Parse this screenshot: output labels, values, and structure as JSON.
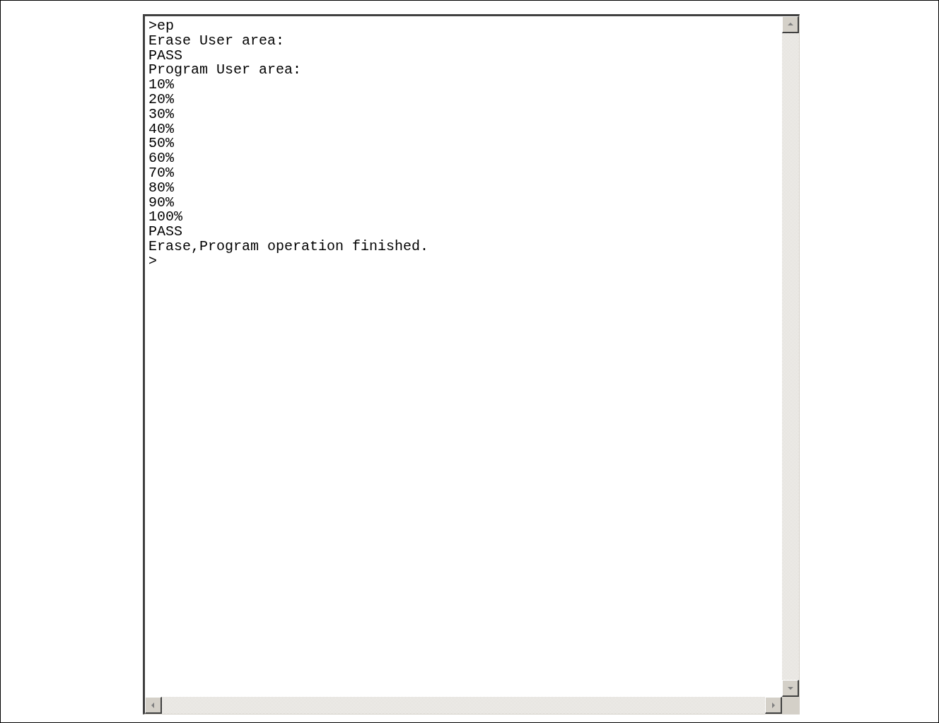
{
  "terminal": {
    "lines": [
      ">ep",
      "Erase User area:",
      "PASS",
      "Program User area:",
      "10%",
      "20%",
      "30%",
      "40%",
      "50%",
      "60%",
      "70%",
      "80%",
      "90%",
      "100%",
      "PASS",
      "Erase,Program operation finished.",
      ">"
    ]
  }
}
